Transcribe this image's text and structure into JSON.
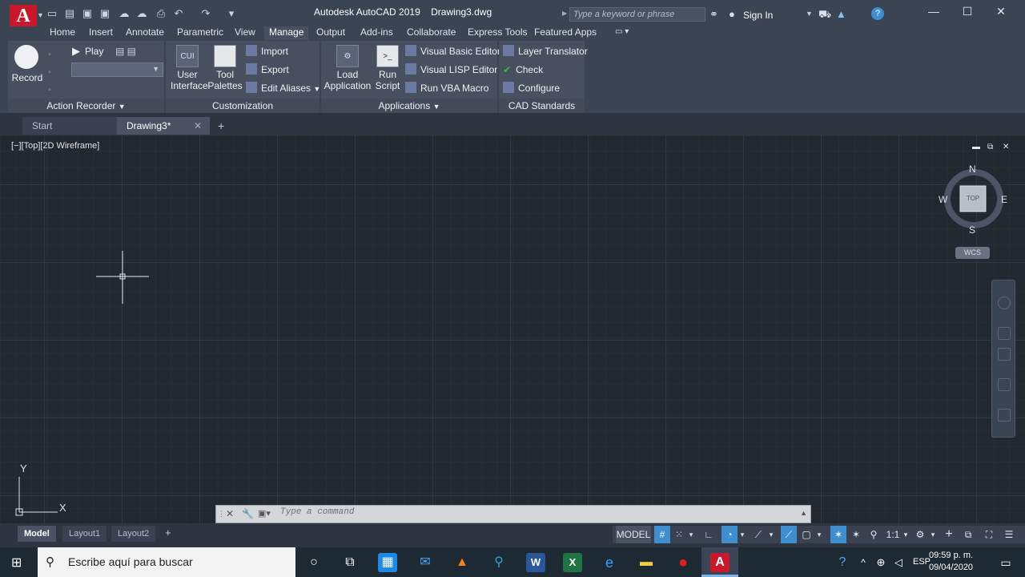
{
  "app": {
    "title": "Autodesk AutoCAD 2019",
    "document": "Drawing3.dwg",
    "logo_letter": "A",
    "search_placeholder": "Type a keyword or phrase",
    "sign_in": "Sign In"
  },
  "ribbon_tabs": [
    "Home",
    "Insert",
    "Annotate",
    "Parametric",
    "View",
    "Manage",
    "Output",
    "Add-ins",
    "Collaborate",
    "Express Tools",
    "Featured Apps"
  ],
  "active_tab": "Manage",
  "ribbon": {
    "action_recorder": {
      "record": "Record",
      "play": "Play",
      "title": "Action Recorder"
    },
    "customization": {
      "user_interface": "User Interface",
      "cui_icon": "CUI",
      "tool_palettes": "Tool Palettes",
      "import": "Import",
      "export": "Export",
      "edit_aliases": "Edit Aliases",
      "title": "Customization"
    },
    "applications": {
      "load_application": "Load Application",
      "run_script": "Run Script",
      "visual_basic_editor": "Visual Basic Editor",
      "visual_lisp_editor": "Visual LISP Editor",
      "run_vba_macro": "Run VBA Macro",
      "title": "Applications"
    },
    "cad_standards": {
      "layer_translator": "Layer Translator",
      "check": "Check",
      "configure": "Configure",
      "title": "CAD Standards"
    }
  },
  "file_tabs": {
    "start": "Start",
    "drawing": "Drawing3*"
  },
  "viewport": {
    "label": "[−][Top][2D Wireframe]"
  },
  "viewcube": {
    "n": "N",
    "s": "S",
    "e": "E",
    "w": "W",
    "face": "TOP",
    "wcs": "WCS"
  },
  "ucs": {
    "x": "X",
    "y": "Y"
  },
  "command": {
    "placeholder": "Type  a  command"
  },
  "layout_tabs": [
    "Model",
    "Layout1",
    "Layout2"
  ],
  "status": {
    "model": "MODEL",
    "scale": "1:1"
  },
  "taskbar": {
    "search": "Escribe aquí para buscar",
    "lang": "ESP",
    "time": "09:59 p. m.",
    "date": "09/04/2020"
  },
  "colors": {
    "accent": "#3e8ed0",
    "autocad_red": "#c8182b"
  }
}
